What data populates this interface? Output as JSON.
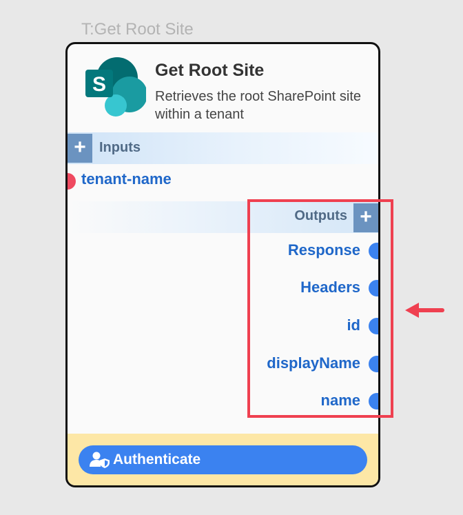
{
  "node_tag": "T:Get Root Site",
  "card": {
    "title": "Get Root Site",
    "description": "Retrieves the root SharePoint site within a tenant",
    "logo_icon": "sharepoint-logo-icon",
    "logo_letter": "S"
  },
  "inputs": {
    "header_label": "Inputs",
    "add_symbol": "+",
    "items": [
      {
        "label": "tenant-name"
      }
    ]
  },
  "outputs": {
    "header_label": "Outputs",
    "add_symbol": "+",
    "items": [
      {
        "label": "Response"
      },
      {
        "label": "Headers"
      },
      {
        "label": "id"
      },
      {
        "label": "displayName"
      },
      {
        "label": "name"
      }
    ]
  },
  "auth": {
    "label": "Authenticate",
    "icon": "user-shield-icon"
  },
  "colors": {
    "port_required": "#ef4a60",
    "port_output": "#3b82ef",
    "label_blue": "#1f67c9",
    "auth_button": "#3b82f0",
    "auth_area": "#fde7a6",
    "highlight": "#ef4050"
  }
}
